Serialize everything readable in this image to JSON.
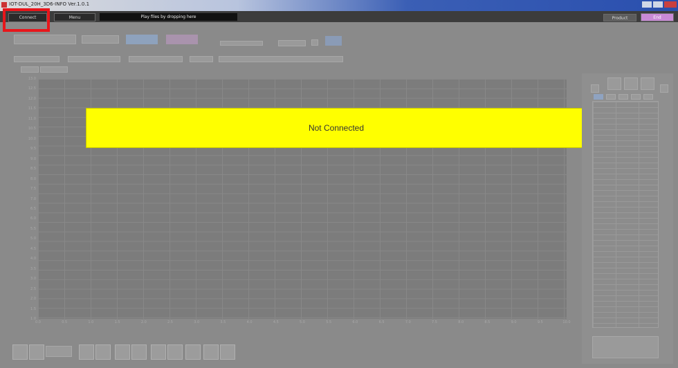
{
  "window": {
    "title": "IOT-DUL_20H_3D6-INFO Ver.1.0.1"
  },
  "toolbar": {
    "connect_label": "Connect",
    "menu_label": "Menu",
    "drop_hint": "Play files by dropping here",
    "product_label": "Product",
    "end_label": "End"
  },
  "status": {
    "banner_text": "Not Connected"
  },
  "chart_data": {
    "type": "line",
    "title": "",
    "xlabel": "",
    "ylabel": "",
    "y_ticks": [
      "13.0",
      "12.5",
      "12.0",
      "11.5",
      "11.0",
      "10.5",
      "10.0",
      "9.5",
      "9.0",
      "8.5",
      "8.0",
      "7.5",
      "7.0",
      "6.5",
      "6.0",
      "5.5",
      "5.0",
      "4.5",
      "4.0",
      "3.5",
      "3.0",
      "2.5",
      "2.0",
      "1.5",
      "1.0"
    ],
    "x_ticks": [
      "0.0",
      "0.5",
      "1.0",
      "1.5",
      "2.0",
      "2.5",
      "3.0",
      "3.5",
      "4.0",
      "4.5",
      "5.0",
      "5.5",
      "6.0",
      "6.5",
      "7.0",
      "7.5",
      "8.0",
      "8.5",
      "9.0",
      "9.5",
      "10.0"
    ],
    "series": [],
    "grid": true
  },
  "colors": {
    "highlight": "#e8161b",
    "banner": "#ffff00",
    "end_button": "#c98ad6"
  }
}
